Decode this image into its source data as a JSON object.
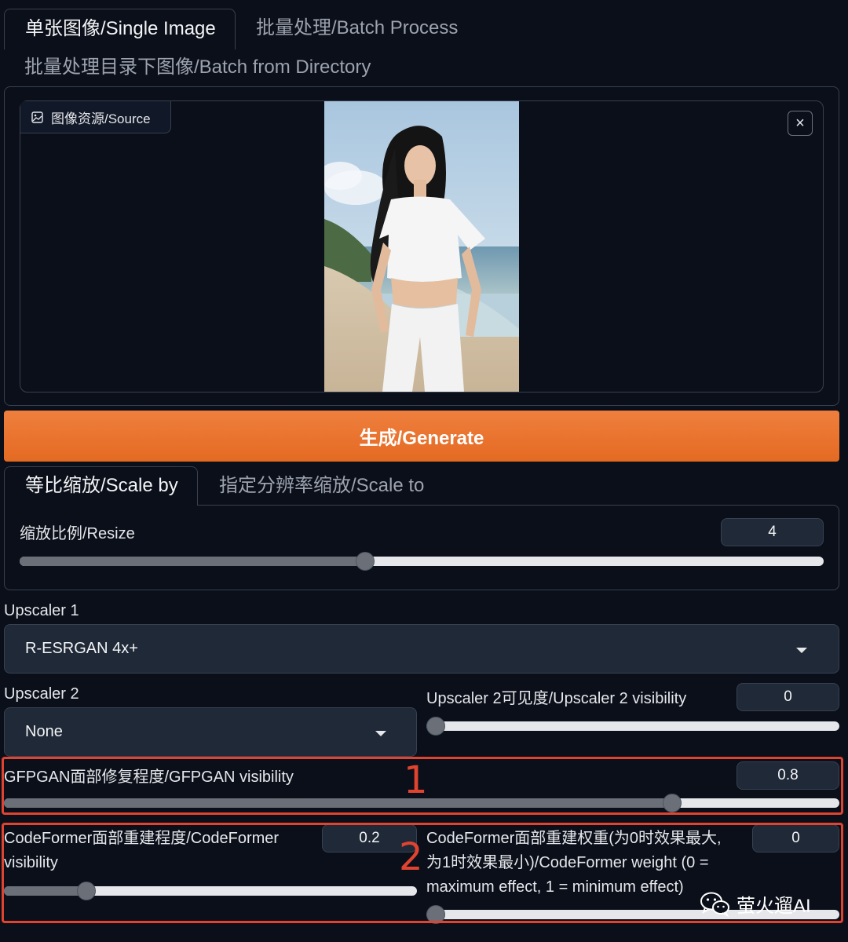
{
  "tabs_top": {
    "single": "单张图像/Single Image",
    "batch": "批量处理/Batch Process",
    "directory": "批量处理目录下图像/Batch from Directory"
  },
  "source": {
    "label": "图像资源/Source",
    "close": "×"
  },
  "generate_label": "生成/Generate",
  "scale_tabs": {
    "scale_by": "等比缩放/Scale by",
    "scale_to": "指定分辨率缩放/Scale to"
  },
  "resize": {
    "label": "缩放比例/Resize",
    "value": "4",
    "level": 0.43
  },
  "upscaler1": {
    "label": "Upscaler 1",
    "selected": "R-ESRGAN 4x+"
  },
  "upscaler2": {
    "label": "Upscaler 2",
    "selected": "None"
  },
  "upscaler2_visibility": {
    "label": "Upscaler 2可见度/Upscaler 2 visibility",
    "value": "0",
    "level": 0
  },
  "gfpgan": {
    "label": "GFPGAN面部修复程度/GFPGAN visibility",
    "value": "0.8",
    "level": 0.8
  },
  "codeformer_visibility": {
    "label_line1": "CodeFormer面部重建程度/CodeFormer",
    "label_line2": "visibility",
    "value": "0.2",
    "level": 0.2
  },
  "codeformer_weight": {
    "label_line1": "CodeFormer面部重建权重(为0时效果最大,",
    "label_line2": "为1时效果最小)/CodeFormer weight (0 =",
    "label_line3": "maximum effect, 1 = minimum effect)",
    "value": "0",
    "level": 0
  },
  "annotations": {
    "one": "1",
    "two": "2"
  },
  "watermark": "萤火遛AI",
  "colors": {
    "background": "#0b0f19",
    "accent_orange": "#e8722c",
    "annotation_red": "#e0432f"
  },
  "icons": {
    "source": "image-icon",
    "close": "close-icon",
    "dropdown": "caret-down-icon",
    "watermark": "wechat-icon"
  }
}
